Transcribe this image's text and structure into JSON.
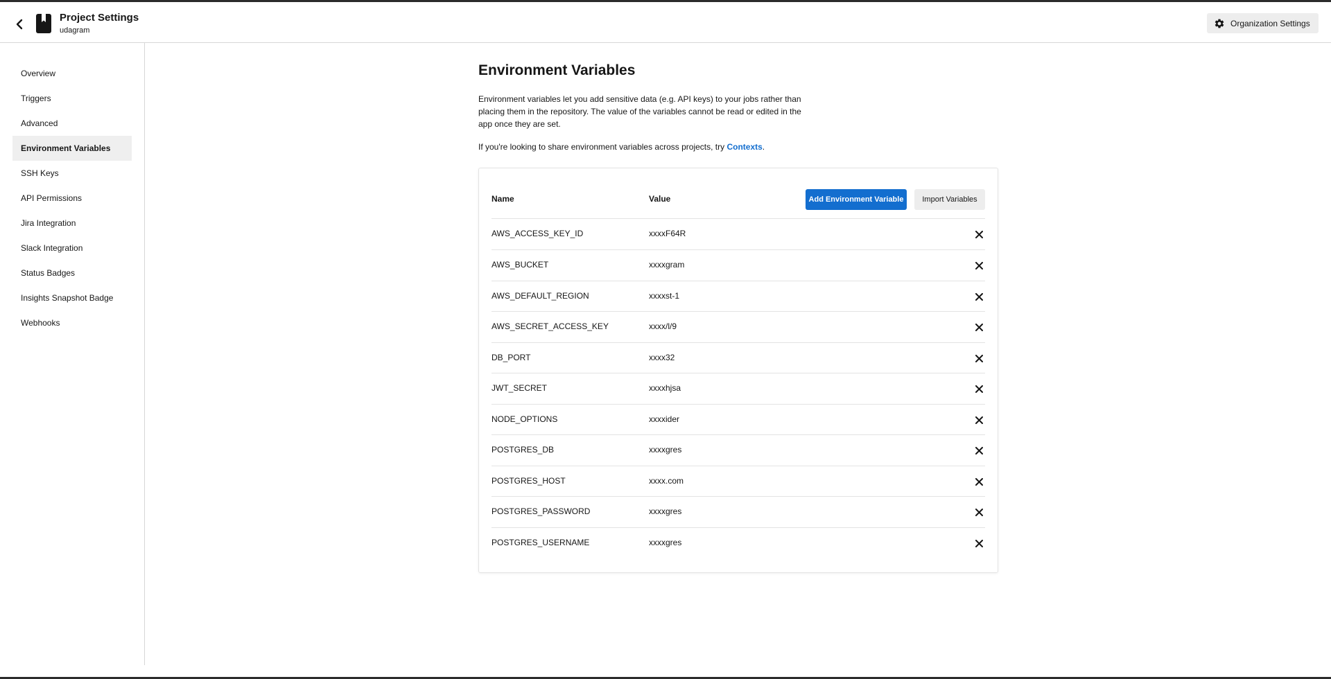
{
  "header": {
    "title": "Project Settings",
    "subtitle": "udagram",
    "org_button": "Organization Settings"
  },
  "sidebar": {
    "items": [
      {
        "label": "Overview",
        "active": false
      },
      {
        "label": "Triggers",
        "active": false
      },
      {
        "label": "Advanced",
        "active": false
      },
      {
        "label": "Environment Variables",
        "active": true
      },
      {
        "label": "SSH Keys",
        "active": false
      },
      {
        "label": "API Permissions",
        "active": false
      },
      {
        "label": "Jira Integration",
        "active": false
      },
      {
        "label": "Slack Integration",
        "active": false
      },
      {
        "label": "Status Badges",
        "active": false
      },
      {
        "label": "Insights Snapshot Badge",
        "active": false
      },
      {
        "label": "Webhooks",
        "active": false
      }
    ]
  },
  "main": {
    "title": "Environment Variables",
    "description": "Environment variables let you add sensitive data (e.g. API keys) to your jobs rather than placing them in the repository. The value of the variables cannot be read or edited in the app once they are set.",
    "share_prefix": "If you're looking to share environment variables across projects, try ",
    "share_link": "Contexts",
    "share_suffix": "."
  },
  "table": {
    "col_name": "Name",
    "col_value": "Value",
    "add_button": "Add Environment Variable",
    "import_button": "Import Variables",
    "rows": [
      {
        "name": "AWS_ACCESS_KEY_ID",
        "value": "xxxxF64R"
      },
      {
        "name": "AWS_BUCKET",
        "value": "xxxxgram"
      },
      {
        "name": "AWS_DEFAULT_REGION",
        "value": "xxxxst-1"
      },
      {
        "name": "AWS_SECRET_ACCESS_KEY",
        "value": "xxxx/l/9"
      },
      {
        "name": "DB_PORT",
        "value": "xxxx32"
      },
      {
        "name": "JWT_SECRET",
        "value": "xxxxhjsa"
      },
      {
        "name": "NODE_OPTIONS",
        "value": "xxxxider"
      },
      {
        "name": "POSTGRES_DB",
        "value": "xxxxgres"
      },
      {
        "name": "POSTGRES_HOST",
        "value": "xxxx.com"
      },
      {
        "name": "POSTGRES_PASSWORD",
        "value": "xxxxgres"
      },
      {
        "name": "POSTGRES_USERNAME",
        "value": "xxxxgres"
      }
    ]
  },
  "colors": {
    "accent": "#136ecf",
    "active_bg": "#efefef",
    "border": "#e3e3e3"
  },
  "icons": {
    "back": "chevron-left-icon",
    "project": "book-icon",
    "settings": "gear-icon",
    "delete": "close-icon"
  }
}
